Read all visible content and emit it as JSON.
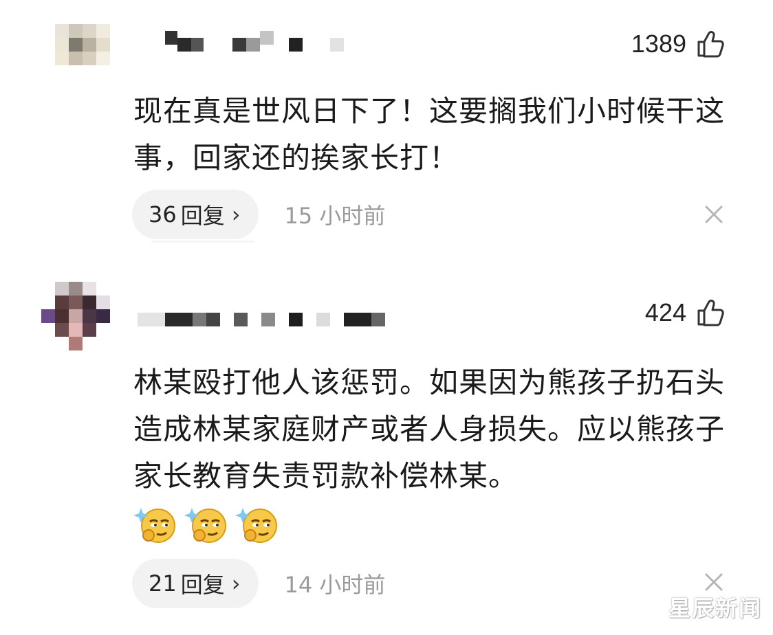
{
  "comments": [
    {
      "likes": "1389",
      "text": "现在真是世风日下了！这要搁我们小时候干这事，回家还的挨家长打！",
      "reply_count": "36",
      "reply_label": "回复",
      "reply_chevron": "›",
      "time": "15 小时前",
      "like_icon": "thumbs-up-icon",
      "close_icon": "close-icon"
    },
    {
      "likes": "424",
      "text": "林某殴打他人该惩罚。如果因为熊孩子扔石头造成林某家庭财产或者人身损失。应以熊孩子家长教育失责罚款补偿林某。",
      "emojis": [
        "smirk-emoji-icon",
        "smirk-emoji-icon",
        "smirk-emoji-icon"
      ],
      "reply_count": "21",
      "reply_label": "回复",
      "reply_chevron": "›",
      "time": "14 小时前",
      "like_icon": "thumbs-up-icon",
      "close_icon": "close-icon"
    }
  ],
  "watermark": "星辰新闻",
  "colors": {
    "background": "#ffffff",
    "text": "#1a1a1a",
    "secondary_text": "#9a9a9a",
    "pill_background": "#f2f2f2"
  }
}
